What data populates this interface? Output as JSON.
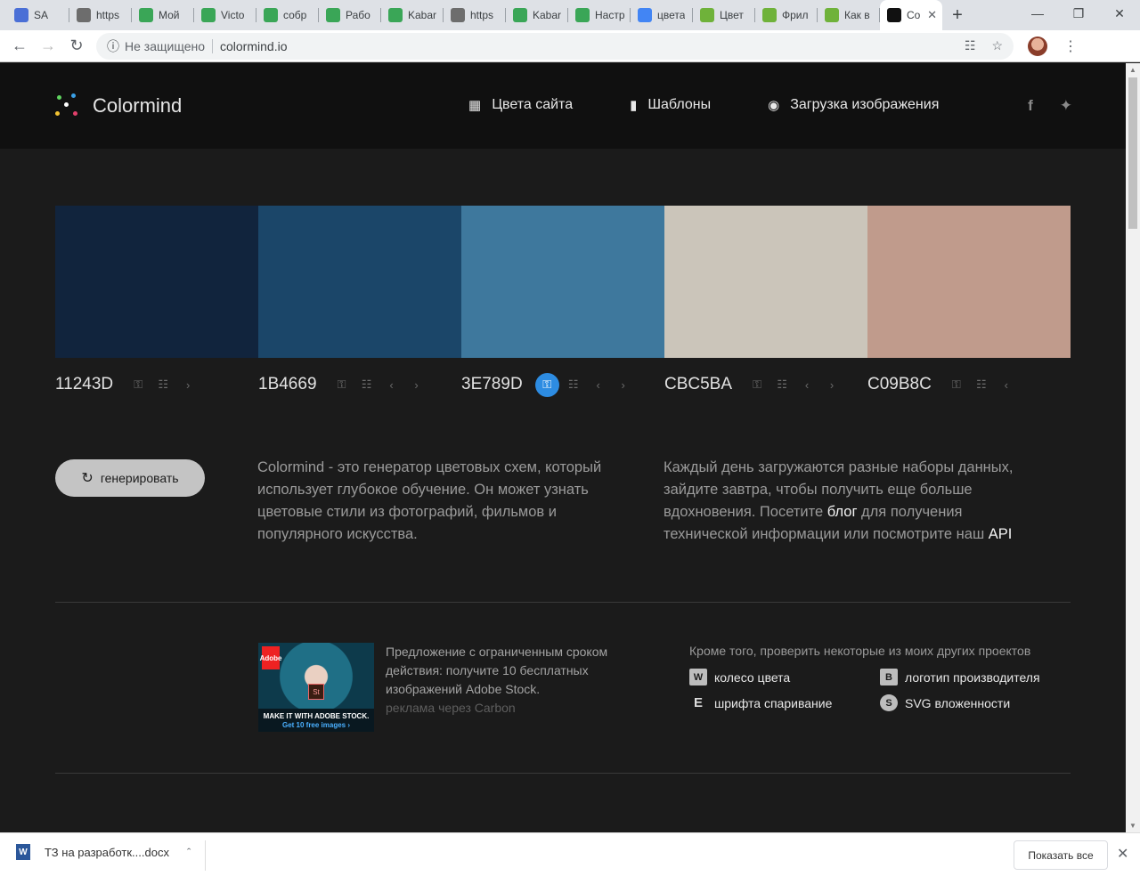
{
  "browser": {
    "tabs": [
      {
        "title": "SA",
        "icon": "play-icon",
        "color": "#4a6fd6"
      },
      {
        "title": "https",
        "icon": "globe-icon",
        "color": "#6d6d6d"
      },
      {
        "title": "Мой",
        "icon": "owl-icon",
        "color": "#3aa657"
      },
      {
        "title": "Victo",
        "icon": "owl-icon",
        "color": "#3aa657"
      },
      {
        "title": "собр",
        "icon": "owl-icon",
        "color": "#3aa657"
      },
      {
        "title": "Рабо",
        "icon": "owl-icon",
        "color": "#3aa657"
      },
      {
        "title": "Kabar",
        "icon": "owl-icon",
        "color": "#3aa657"
      },
      {
        "title": "https",
        "icon": "globe-icon",
        "color": "#6d6d6d"
      },
      {
        "title": "Kabar",
        "icon": "owl-icon",
        "color": "#3aa657"
      },
      {
        "title": "Настр",
        "icon": "owl-icon",
        "color": "#3aa657"
      },
      {
        "title": "цвета",
        "icon": "google-icon",
        "color": "#4285f4"
      },
      {
        "title": "Цвет",
        "icon": "freelance-icon",
        "color": "#6fb23a"
      },
      {
        "title": "Фрил",
        "icon": "freelance-icon",
        "color": "#6fb23a"
      },
      {
        "title": "Как в",
        "icon": "freelance-icon",
        "color": "#6fb23a"
      },
      {
        "title": "Co",
        "icon": "colormind-icon",
        "color": "#111111"
      }
    ],
    "address": {
      "security": "Не защищено",
      "url": "colormind.io"
    }
  },
  "site": {
    "brand": "Colormind",
    "nav": [
      {
        "label": "Цвета сайта",
        "icon": "grid-icon"
      },
      {
        "label": "Шаблоны",
        "icon": "bookmark-icon"
      },
      {
        "label": "Загрузка изображения",
        "icon": "camera-icon"
      }
    ],
    "social": [
      "facebook-icon",
      "twitter-icon"
    ]
  },
  "palette": [
    {
      "hex": "11243D",
      "color": "#11243D",
      "locked": false,
      "prev": false,
      "next": true
    },
    {
      "hex": "1B4669",
      "color": "#1B4669",
      "locked": false,
      "prev": true,
      "next": true
    },
    {
      "hex": "3E789D",
      "color": "#3E789D",
      "locked": true,
      "prev": true,
      "next": true
    },
    {
      "hex": "CBC5BA",
      "color": "#CBC5BA",
      "locked": false,
      "prev": true,
      "next": true
    },
    {
      "hex": "C09B8C",
      "color": "#C09B8C",
      "locked": false,
      "prev": true,
      "next": false
    }
  ],
  "generate_label": "генерировать",
  "intro_text": "Colormind - это генератор цветовых схем, который использует глубокое обучение. Он может узнать цветовые стили из фотографий, фильмов и популярного искусства.",
  "info": {
    "part1": "Каждый день загружаются разные наборы данных, зайдите завтра, чтобы получить еще больше вдохновения. Посетите ",
    "link1": "блог",
    "part2": " для получения технической информации или посмотрите наш ",
    "link2": "API"
  },
  "ad": {
    "brand": "Adobe",
    "product": "St",
    "caption": "MAKE IT WITH ADOBE STOCK.",
    "cta": "Get 10 free images ›",
    "text": "Предложение с ограниченным сроком действия: получите 10 бесплатных изображений Adobe Stock.",
    "via": "реклама через Carbon"
  },
  "other_projects": {
    "heading": "Кроме того, проверить некоторые из моих других проектов",
    "items": [
      {
        "label": "колесо цвета",
        "icon": "color-wheel-icon",
        "glyph": "W"
      },
      {
        "label": "логотип производителя",
        "icon": "logo-maker-icon",
        "glyph": "B"
      },
      {
        "label": "шрифта спаривание",
        "icon": "font-pairing-icon",
        "glyph": "E"
      },
      {
        "label": "SVG вложенности",
        "icon": "svg-nesting-icon",
        "glyph": "S"
      }
    ]
  },
  "download": {
    "file": "ТЗ на разработк....docx",
    "show_all": "Показать все"
  }
}
